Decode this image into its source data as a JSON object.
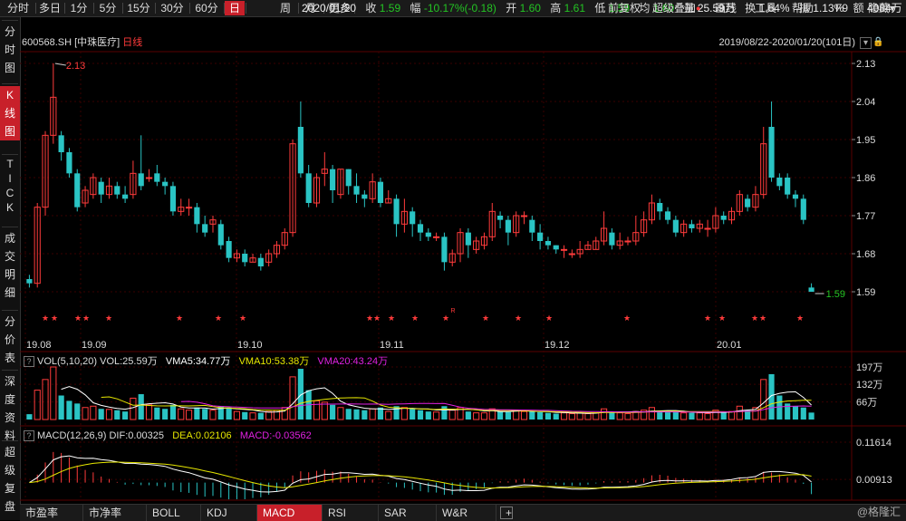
{
  "topbar": {
    "periods": [
      {
        "label": "分时",
        "active": false
      },
      {
        "label": "多日",
        "active": false
      },
      {
        "label": "1分",
        "active": false
      },
      {
        "label": "5分",
        "active": false
      },
      {
        "label": "15分",
        "active": false
      },
      {
        "label": "30分",
        "active": false
      },
      {
        "label": "60分",
        "active": false
      },
      {
        "label": "日",
        "active": true
      },
      {
        "label": "周",
        "active": false
      },
      {
        "label": "月",
        "active": false
      },
      {
        "label": "更多",
        "active": false
      }
    ],
    "quote": {
      "date": "2020/01/20",
      "close_label": "收",
      "close": "1.59",
      "change_label": "幅",
      "change": "-10.17%(-0.18)",
      "open_label": "开",
      "open": "1.60",
      "high_label": "高",
      "high": "1.61",
      "low_label": "低",
      "low": "1.59",
      "avg_label": "均",
      "avg": "1.60",
      "vol_label": "量",
      "vol": "25.59万",
      "turnover_label": "换",
      "turnover": "1.64%",
      "amplitude_label": "振",
      "amplitude": "1.13%",
      "amount_label": "额",
      "amount": "4084万"
    },
    "right_items": [
      "前复权",
      "超级叠加",
      "画线",
      "工具",
      "帮助",
      "F9",
      "隐藏"
    ]
  },
  "leftnav": [
    "分时图",
    "K线图",
    "TICK",
    "成交明细",
    "分价表",
    "深度资料",
    "超级复盘"
  ],
  "info": {
    "code": "600568.SH",
    "name": "[中珠医疗]",
    "period": "日线",
    "range": "2019/08/22-2020/01/20(101日)"
  },
  "colors": {
    "up": "#ff3b3b",
    "down": "#2ac4c4",
    "ma5": "#ffffff",
    "ma10": "#e6e600",
    "ma20": "#e020e0",
    "bg": "#000000",
    "grid": "#3a0000"
  },
  "kline": {
    "y_ticks": [
      "2.13",
      "2.04",
      "1.95",
      "1.86",
      "1.77",
      "1.68",
      "1.59"
    ],
    "x_ticks": [
      "19.08",
      "19.09",
      "19.10",
      "19.11",
      "19.12",
      "20.01"
    ],
    "high_marker": "2.13",
    "last_marker": "1.59",
    "r_marker": "R",
    "star": "★"
  },
  "volume": {
    "title": "VOL(5,10,20)",
    "vol_label": "VOL:25.59万",
    "vma5": "VMA5:34.77万",
    "vma10": "VMA10:53.38万",
    "vma20": "VMA20:43.24万",
    "y_ticks": [
      "197万",
      "132万",
      "66万"
    ]
  },
  "macd": {
    "title": "MACD(12,26,9)",
    "dif": "DIF:0.00325",
    "dea": "DEA:0.02106",
    "macd": "MACD:-0.03562",
    "y_ticks": [
      "0.11614",
      "0.00913"
    ]
  },
  "tabs": [
    {
      "label": "市盈率",
      "active": false
    },
    {
      "label": "市净率",
      "active": false
    },
    {
      "label": "BOLL",
      "active": false
    },
    {
      "label": "KDJ",
      "active": false
    },
    {
      "label": "MACD",
      "active": true
    },
    {
      "label": "RSI",
      "active": false
    },
    {
      "label": "SAR",
      "active": false
    },
    {
      "label": "W&R",
      "active": false
    },
    {
      "label": "+",
      "active": false
    }
  ],
  "watermark": "@格隆汇",
  "chart_data": {
    "type": "candlestick",
    "title": "600568.SH [中珠医疗] 日线",
    "ylim": [
      1.59,
      2.13
    ],
    "candles": [
      [
        1.62,
        1.61,
        1.63,
        1.6
      ],
      [
        1.61,
        1.79,
        1.8,
        1.6
      ],
      [
        1.79,
        1.96,
        1.97,
        1.77
      ],
      [
        1.96,
        2.05,
        2.13,
        1.94
      ],
      [
        1.96,
        1.92,
        1.97,
        1.9
      ],
      [
        1.92,
        1.87,
        1.93,
        1.86
      ],
      [
        1.87,
        1.79,
        1.88,
        1.78
      ],
      [
        1.8,
        1.83,
        1.84,
        1.79
      ],
      [
        1.82,
        1.86,
        1.87,
        1.81
      ],
      [
        1.85,
        1.82,
        1.86,
        1.8
      ],
      [
        1.82,
        1.84,
        1.86,
        1.81
      ],
      [
        1.84,
        1.82,
        1.85,
        1.81
      ],
      [
        1.82,
        1.81,
        1.84,
        1.8
      ],
      [
        1.82,
        1.87,
        1.9,
        1.81
      ],
      [
        1.87,
        1.84,
        1.96,
        1.83
      ],
      [
        1.86,
        1.86,
        1.88,
        1.85
      ],
      [
        1.87,
        1.85,
        1.89,
        1.84
      ],
      [
        1.85,
        1.84,
        1.86,
        1.82
      ],
      [
        1.84,
        1.78,
        1.85,
        1.77
      ],
      [
        1.78,
        1.79,
        1.81,
        1.77
      ],
      [
        1.79,
        1.79,
        1.81,
        1.77
      ],
      [
        1.79,
        1.75,
        1.8,
        1.73
      ],
      [
        1.75,
        1.73,
        1.77,
        1.72
      ],
      [
        1.75,
        1.76,
        1.77,
        1.73
      ],
      [
        1.75,
        1.7,
        1.76,
        1.69
      ],
      [
        1.71,
        1.67,
        1.72,
        1.66
      ],
      [
        1.67,
        1.68,
        1.69,
        1.66
      ],
      [
        1.68,
        1.66,
        1.69,
        1.65
      ],
      [
        1.66,
        1.67,
        1.68,
        1.66
      ],
      [
        1.67,
        1.65,
        1.68,
        1.64
      ],
      [
        1.66,
        1.68,
        1.69,
        1.65
      ],
      [
        1.68,
        1.7,
        1.71,
        1.67
      ],
      [
        1.7,
        1.73,
        1.74,
        1.69
      ],
      [
        1.73,
        1.94,
        1.95,
        1.72
      ],
      [
        1.98,
        1.87,
        2.04,
        1.86
      ],
      [
        1.87,
        1.8,
        1.89,
        1.79
      ],
      [
        1.8,
        1.86,
        1.87,
        1.79
      ],
      [
        1.87,
        1.88,
        1.92,
        1.84
      ],
      [
        1.88,
        1.83,
        1.89,
        1.8
      ],
      [
        1.82,
        1.88,
        1.88,
        1.81
      ],
      [
        1.88,
        1.84,
        1.88,
        1.82
      ],
      [
        1.84,
        1.82,
        1.87,
        1.8
      ],
      [
        1.82,
        1.81,
        1.83,
        1.79
      ],
      [
        1.81,
        1.85,
        1.87,
        1.8
      ],
      [
        1.85,
        1.8,
        1.86,
        1.79
      ],
      [
        1.8,
        1.81,
        1.83,
        1.8
      ],
      [
        1.81,
        1.75,
        1.82,
        1.72
      ],
      [
        1.75,
        1.78,
        1.81,
        1.73
      ],
      [
        1.78,
        1.75,
        1.79,
        1.72
      ],
      [
        1.75,
        1.73,
        1.76,
        1.71
      ],
      [
        1.73,
        1.72,
        1.74,
        1.71
      ],
      [
        1.72,
        1.72,
        1.73,
        1.71
      ],
      [
        1.72,
        1.66,
        1.73,
        1.64
      ],
      [
        1.66,
        1.68,
        1.69,
        1.65
      ],
      [
        1.68,
        1.73,
        1.74,
        1.66
      ],
      [
        1.73,
        1.7,
        1.74,
        1.67
      ],
      [
        1.69,
        1.71,
        1.72,
        1.68
      ],
      [
        1.7,
        1.72,
        1.73,
        1.69
      ],
      [
        1.72,
        1.78,
        1.8,
        1.71
      ],
      [
        1.77,
        1.76,
        1.78,
        1.74
      ],
      [
        1.76,
        1.73,
        1.77,
        1.7
      ],
      [
        1.73,
        1.77,
        1.78,
        1.72
      ],
      [
        1.77,
        1.77,
        1.78,
        1.75
      ],
      [
        1.76,
        1.73,
        1.77,
        1.71
      ],
      [
        1.73,
        1.71,
        1.75,
        1.69
      ],
      [
        1.71,
        1.7,
        1.72,
        1.69
      ],
      [
        1.7,
        1.69,
        1.7,
        1.68
      ],
      [
        1.69,
        1.69,
        1.7,
        1.67
      ],
      [
        1.68,
        1.68,
        1.69,
        1.67
      ],
      [
        1.68,
        1.69,
        1.71,
        1.67
      ],
      [
        1.69,
        1.7,
        1.71,
        1.69
      ],
      [
        1.69,
        1.71,
        1.72,
        1.69
      ],
      [
        1.71,
        1.74,
        1.78,
        1.7
      ],
      [
        1.73,
        1.7,
        1.74,
        1.69
      ],
      [
        1.7,
        1.71,
        1.73,
        1.69
      ],
      [
        1.71,
        1.71,
        1.72,
        1.7
      ],
      [
        1.71,
        1.73,
        1.77,
        1.7
      ],
      [
        1.73,
        1.76,
        1.78,
        1.72
      ],
      [
        1.76,
        1.8,
        1.82,
        1.75
      ],
      [
        1.8,
        1.78,
        1.81,
        1.76
      ],
      [
        1.78,
        1.76,
        1.79,
        1.75
      ],
      [
        1.76,
        1.73,
        1.77,
        1.72
      ],
      [
        1.73,
        1.75,
        1.76,
        1.72
      ],
      [
        1.75,
        1.74,
        1.76,
        1.73
      ],
      [
        1.74,
        1.75,
        1.76,
        1.73
      ],
      [
        1.74,
        1.74,
        1.76,
        1.72
      ],
      [
        1.74,
        1.77,
        1.79,
        1.73
      ],
      [
        1.77,
        1.76,
        1.78,
        1.75
      ],
      [
        1.76,
        1.78,
        1.79,
        1.75
      ],
      [
        1.78,
        1.82,
        1.83,
        1.77
      ],
      [
        1.81,
        1.79,
        1.82,
        1.78
      ],
      [
        1.79,
        1.82,
        1.84,
        1.78
      ],
      [
        1.82,
        1.94,
        1.98,
        1.81
      ],
      [
        1.98,
        1.86,
        2.04,
        1.85
      ],
      [
        1.86,
        1.84,
        1.87,
        1.83
      ],
      [
        1.86,
        1.82,
        1.87,
        1.81
      ],
      [
        1.82,
        1.81,
        1.83,
        1.79
      ],
      [
        1.81,
        1.76,
        1.82,
        1.75
      ],
      [
        1.6,
        1.59,
        1.61,
        1.59
      ]
    ],
    "volume_wan": [
      20,
      110,
      150,
      197,
      90,
      70,
      60,
      45,
      50,
      40,
      38,
      35,
      30,
      80,
      95,
      55,
      45,
      40,
      55,
      40,
      35,
      45,
      40,
      35,
      50,
      45,
      30,
      28,
      25,
      25,
      30,
      35,
      45,
      160,
      190,
      110,
      70,
      65,
      55,
      45,
      40,
      38,
      35,
      40,
      45,
      30,
      50,
      45,
      40,
      35,
      30,
      28,
      50,
      35,
      45,
      30,
      25,
      25,
      40,
      30,
      28,
      35,
      30,
      30,
      28,
      25,
      22,
      25,
      22,
      25,
      22,
      25,
      40,
      30,
      25,
      22,
      30,
      35,
      45,
      30,
      28,
      30,
      25,
      25,
      25,
      22,
      35,
      28,
      30,
      50,
      35,
      45,
      150,
      170,
      90,
      60,
      50,
      45,
      26
    ],
    "vol_ylim": [
      0,
      197
    ],
    "macd_ylim": [
      -0.04,
      0.11614
    ]
  }
}
